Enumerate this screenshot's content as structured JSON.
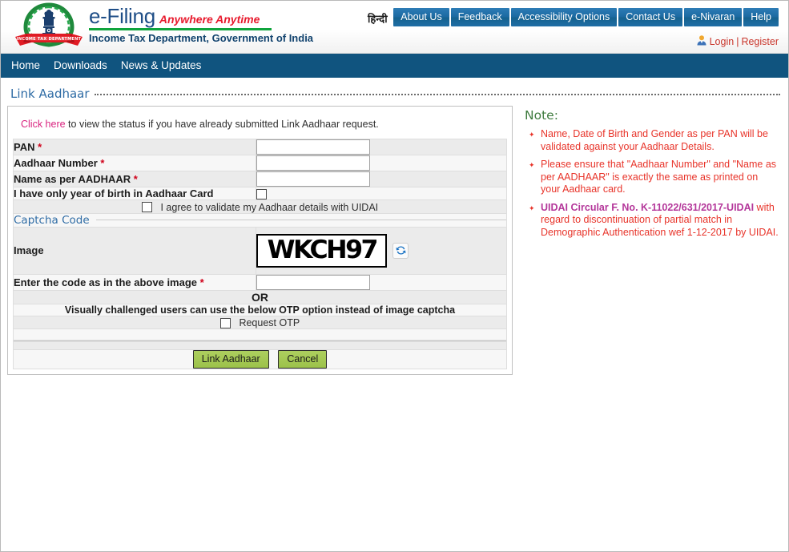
{
  "header": {
    "logo_icon": "income-tax-department-emblem",
    "brand_title": "e-Filing",
    "brand_tagline": "Anywhere Anytime",
    "brand_subtitle": "Income Tax Department, Government of India",
    "hindi_label": "हिन्दी",
    "top_nav": [
      {
        "label": "About Us"
      },
      {
        "label": "Feedback"
      },
      {
        "label": "Accessibility Options"
      },
      {
        "label": "Contact Us"
      },
      {
        "label": "e-Nivaran"
      },
      {
        "label": "Help"
      }
    ],
    "account": {
      "avatar_icon": "user-avatar-icon",
      "login_label": "Login",
      "separator": "|",
      "register_label": "Register"
    }
  },
  "main_nav": [
    {
      "label": "Home"
    },
    {
      "label": "Downloads"
    },
    {
      "label": "News & Updates"
    }
  ],
  "page": {
    "title": "Link Aadhaar"
  },
  "form": {
    "intro_link": "Click here",
    "intro_text": " to view the status if you have already submitted Link Aadhaar request.",
    "fields": {
      "pan_label": "PAN",
      "pan_required": "*",
      "pan_value": "",
      "aadhaar_label": "Aadhaar Number",
      "aadhaar_required": "*",
      "aadhaar_value": "",
      "name_label": "Name as per AADHAAR",
      "name_required": "*",
      "name_value": "",
      "year_only_label": "I have only year of birth in Aadhaar Card",
      "year_only_checked": false,
      "agree_label": "I agree to validate my Aadhaar details with UIDAI",
      "agree_checked": false
    },
    "captcha": {
      "section_title": "Captcha Code",
      "image_label": "Image",
      "image_text": "WKCH97",
      "refresh_icon": "refresh-icon",
      "code_label": "Enter the code as in the above image",
      "code_required": "*",
      "code_value": ""
    },
    "otp": {
      "or_label": "OR",
      "hint": "Visually challenged users can use the below OTP option instead of image captcha",
      "request_otp_label": "Request OTP",
      "request_otp_checked": false
    },
    "buttons": {
      "submit_label": "Link Aadhaar",
      "cancel_label": "Cancel"
    }
  },
  "note": {
    "title": "Note:",
    "items": [
      {
        "text": "Name, Date of Birth and Gender as per PAN will be validated against your Aadhaar Details."
      },
      {
        "text": "Please ensure that \"Aadhaar Number\" and \"Name as per AADHAAR\" is exactly the same as printed on your Aadhaar card."
      },
      {
        "link": "UIDAI Circular F. No. K-11022/631/2017-UIDAI",
        "text": " with regard to discontinuation of partial match in Demographic Authentication wef 1-12-2017 by UIDAI."
      }
    ]
  },
  "colors": {
    "nav_blue": "#10547f",
    "brand_blue": "#1f4e87",
    "tagline_red": "#e8192c",
    "green_rule": "#0fa43c",
    "link_pink": "#d9237f",
    "note_red": "#e8342a",
    "note_link_purple": "#b4379a",
    "button_green": "#9cc24a",
    "account_red": "#c9352b",
    "note_title_green": "#3f7c3f"
  }
}
